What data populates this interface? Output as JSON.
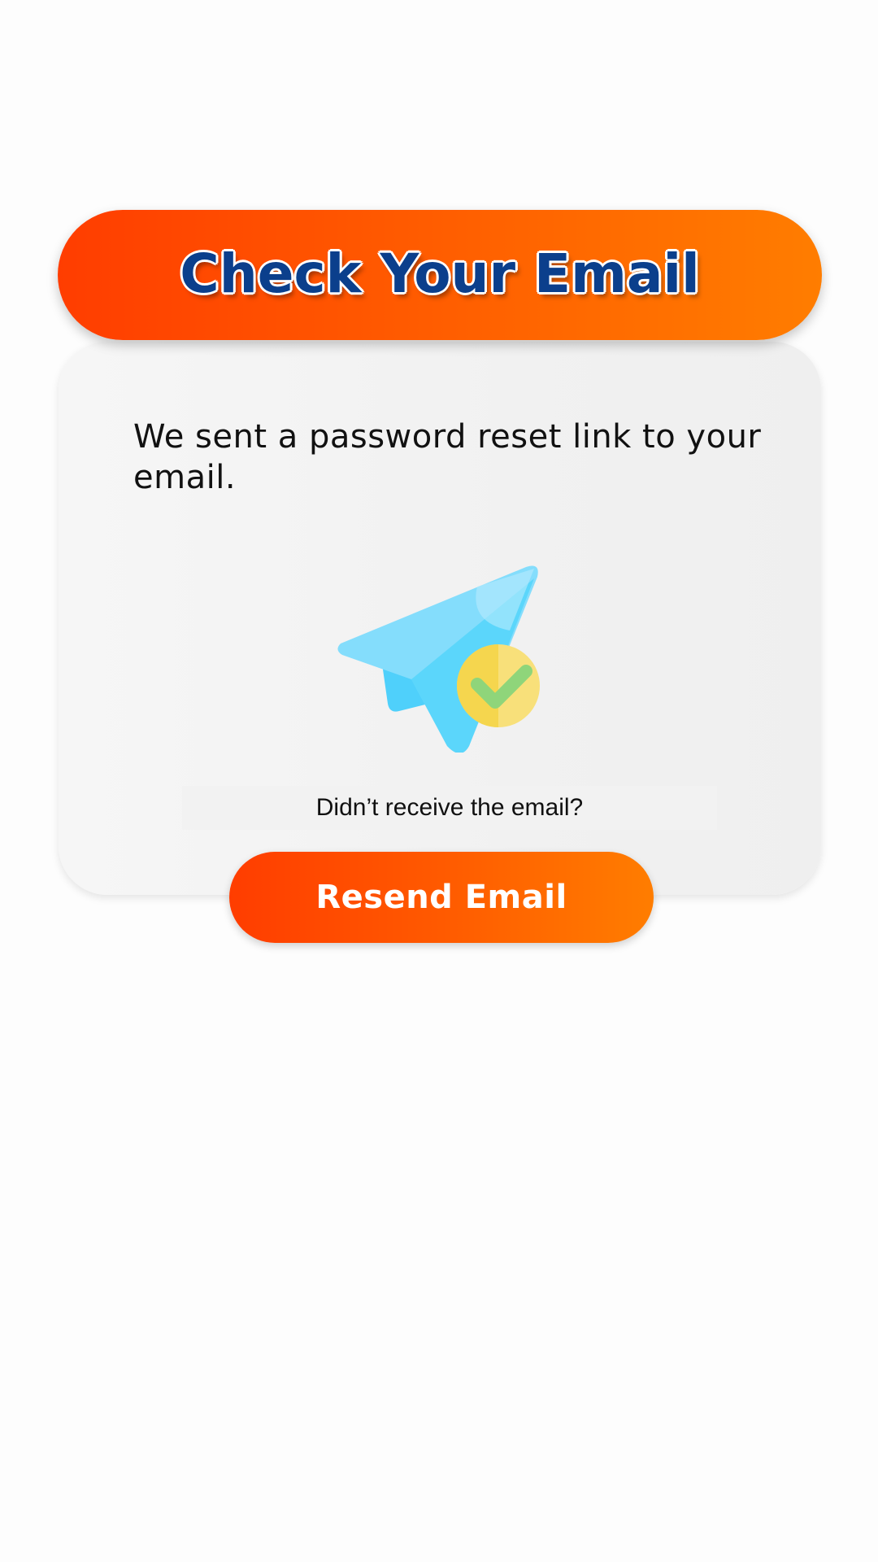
{
  "header": {
    "title": "Check Your Email"
  },
  "card": {
    "message": "We sent a password reset link to your email.",
    "illustration_icon": "paper-plane-check-icon",
    "question": "Didn’t receive the email?"
  },
  "actions": {
    "resend_label": "Resend Email"
  },
  "colors": {
    "accent_start": "#ff3d00",
    "accent_end": "#ff7d00",
    "title_text": "#0b3f8c",
    "plane_blue": "#7fdcfb",
    "check_badge": "#f7dd5c",
    "check_mark": "#8fd57a"
  }
}
